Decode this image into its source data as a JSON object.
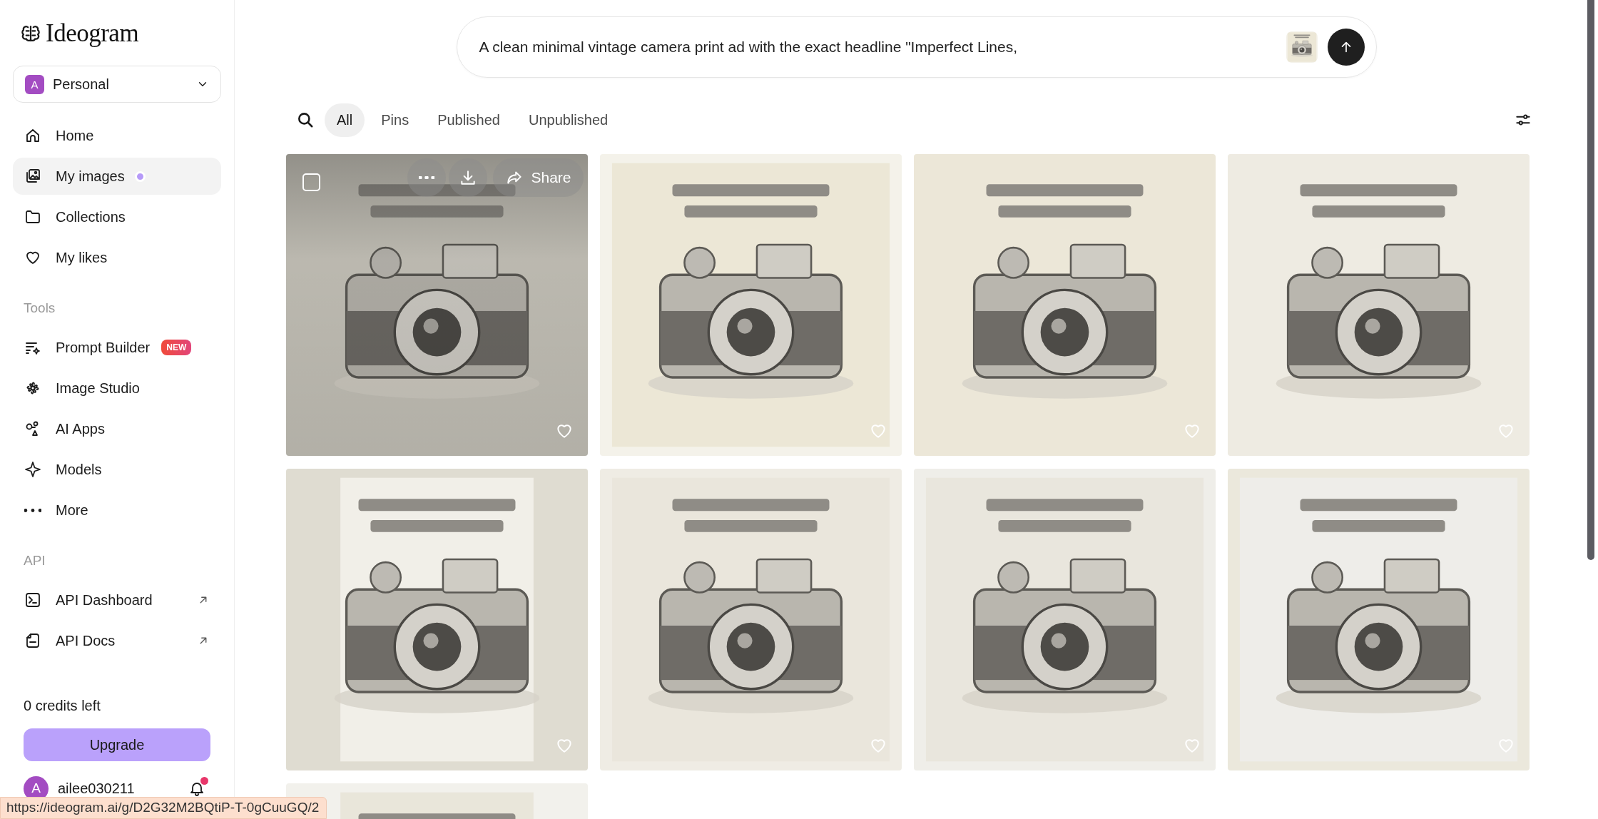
{
  "sidebar": {
    "logo": "Ideogram",
    "workspace": {
      "avatar": "A",
      "name": "Personal"
    },
    "nav": [
      {
        "label": "Home",
        "selected": false,
        "dot": false
      },
      {
        "label": "My images",
        "selected": true,
        "dot": true
      },
      {
        "label": "Collections",
        "selected": false,
        "dot": false
      },
      {
        "label": "My likes",
        "selected": false,
        "dot": false
      }
    ],
    "sections": [
      {
        "title": "Tools",
        "items": [
          {
            "label": "Prompt Builder",
            "badge": "NEW",
            "external": false
          },
          {
            "label": "Image Studio",
            "external": false
          },
          {
            "label": "AI Apps",
            "external": false
          },
          {
            "label": "Models",
            "external": false
          },
          {
            "label": "More",
            "external": false
          }
        ]
      },
      {
        "title": "API",
        "items": [
          {
            "label": "API Dashboard",
            "external": true
          },
          {
            "label": "API Docs",
            "external": true
          }
        ]
      }
    ],
    "credits": "0 credits left",
    "upgrade": "Upgrade",
    "user": {
      "avatar": "A",
      "name": "ailee030211",
      "notification": true
    }
  },
  "prompt": {
    "value": "A clean minimal vintage camera print ad with the exact headline \"Imperfect Lines,"
  },
  "filters": [
    {
      "label": "All",
      "selected": true
    },
    {
      "label": "Pins",
      "selected": false
    },
    {
      "label": "Published",
      "selected": false
    },
    {
      "label": "Unpublished",
      "selected": false
    }
  ],
  "gallery": {
    "share_label": "Share",
    "images": [
      {
        "kind": "picture",
        "hovered": true,
        "selected": false
      },
      {
        "kind": "picture",
        "hovered": false,
        "selected": false
      },
      {
        "kind": "picture",
        "hovered": false,
        "selected": false
      },
      {
        "kind": "picture",
        "hovered": false,
        "selected": false
      },
      {
        "kind": "picture",
        "hovered": false,
        "selected": false
      },
      {
        "kind": "picture",
        "hovered": false,
        "selected": false
      },
      {
        "kind": "picture",
        "hovered": false,
        "selected": false
      },
      {
        "kind": "picture",
        "hovered": false,
        "selected": false
      }
    ],
    "partial_row": [
      {
        "kind": "picture"
      }
    ]
  },
  "status_url": "https://ideogram.ai/g/D2G32M2BQtiP-T-0gCuuGQ/2"
}
